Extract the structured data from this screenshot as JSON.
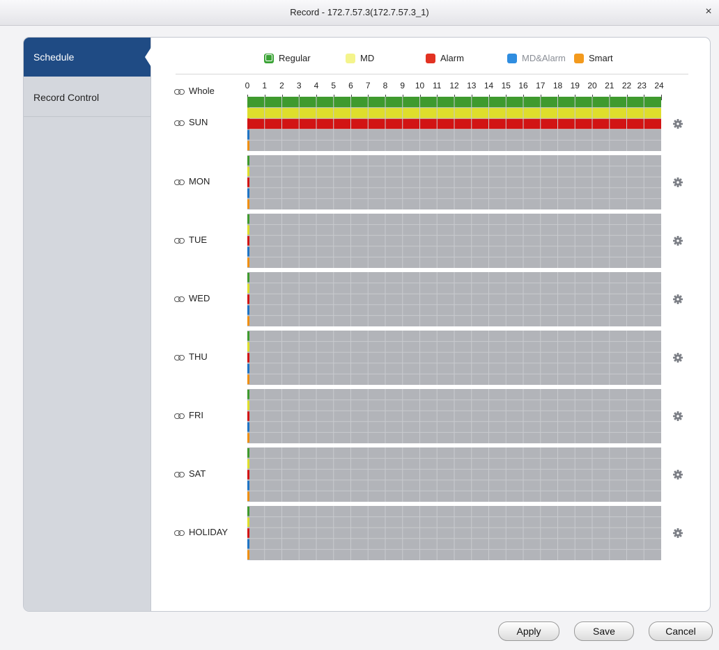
{
  "window": {
    "title": "Record - 172.7.57.3(172.7.57.3_1)",
    "close_glyph": "×"
  },
  "sidebar": {
    "items": [
      {
        "label": "Schedule",
        "active": true
      },
      {
        "label": "Record Control",
        "active": false
      }
    ]
  },
  "legend": {
    "items": [
      {
        "label": "Regular",
        "color": "#3aa335",
        "checked": true
      },
      {
        "label": "MD",
        "color": "#f4f48c",
        "checked": false
      },
      {
        "label": "Alarm",
        "color": "#e23222",
        "checked": false
      },
      {
        "label": "MD&Alarm",
        "color": "#2f8de0",
        "checked": false,
        "muted": true
      },
      {
        "label": "Smart",
        "color": "#f39a1d",
        "checked": false
      }
    ]
  },
  "schedule": {
    "whole_label": "Whole",
    "hours": [
      "0",
      "1",
      "2",
      "3",
      "4",
      "5",
      "6",
      "7",
      "8",
      "9",
      "10",
      "11",
      "12",
      "13",
      "14",
      "15",
      "16",
      "17",
      "18",
      "19",
      "20",
      "21",
      "22",
      "23",
      "24"
    ],
    "days": [
      {
        "label": "SUN",
        "full_types": [
          "Regular",
          "MD",
          "Alarm"
        ]
      },
      {
        "label": "MON",
        "full_types": []
      },
      {
        "label": "TUE",
        "full_types": []
      },
      {
        "label": "WED",
        "full_types": []
      },
      {
        "label": "THU",
        "full_types": []
      },
      {
        "label": "FRI",
        "full_types": []
      },
      {
        "label": "SAT",
        "full_types": []
      },
      {
        "label": "HOLIDAY",
        "full_types": []
      }
    ],
    "colors": {
      "Regular": "#3f9a2e",
      "MD": "#dede2c",
      "Alarm": "#d21414",
      "MD&Alarm": "#1f74c4",
      "Smart": "#ef8f12",
      "empty": "#b2b4b9",
      "gridline": "#c8cace"
    }
  },
  "buttons": {
    "apply": "Apply",
    "save": "Save",
    "cancel": "Cancel"
  }
}
